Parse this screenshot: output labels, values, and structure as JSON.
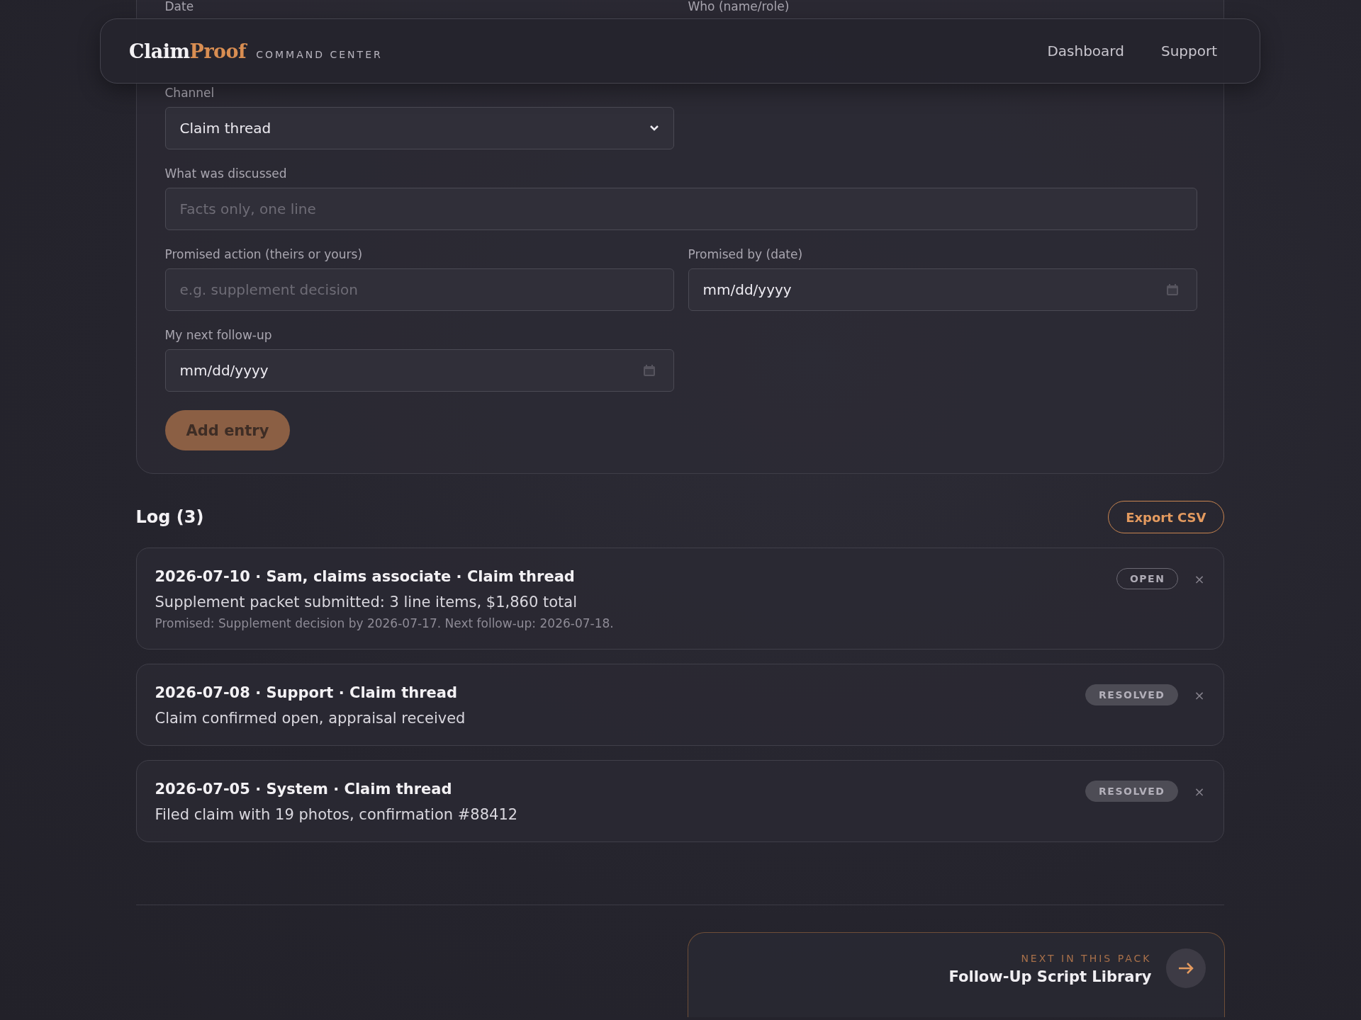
{
  "header": {
    "brand_main": "Claim",
    "brand_accent": "Proof",
    "subtitle": "COMMAND CENTER",
    "nav": [
      {
        "label": "Dashboard"
      },
      {
        "label": "Support"
      }
    ]
  },
  "form": {
    "top_labels": [
      "Date",
      "Who (name/role)"
    ],
    "channel": {
      "label": "Channel",
      "value": "Claim thread"
    },
    "discussed": {
      "label": "What was discussed",
      "placeholder": "Facts only, one line"
    },
    "promised_action": {
      "label": "Promised action (theirs or yours)",
      "placeholder": "e.g. supplement decision"
    },
    "promised_by": {
      "label": "Promised by (date)",
      "value": "mm/dd/yyyy"
    },
    "next_follow_up": {
      "label": "My next follow-up",
      "value": "mm/dd/yyyy"
    },
    "submit": "Add entry"
  },
  "log": {
    "title": "Log (3)",
    "export": "Export CSV",
    "entries": [
      {
        "heading": "2026-07-10 · Sam, claims associate · Claim thread",
        "summary": "Supplement packet submitted: 3 line items, $1,860 total",
        "detail": "Promised: Supplement decision by 2026-07-17. Next follow-up: 2026-07-18.",
        "status": {
          "kind": "open",
          "label": "OPEN"
        },
        "remove": "×"
      },
      {
        "heading": "2026-07-08 · Support · Claim thread",
        "summary": "Claim confirmed open, appraisal received",
        "status": {
          "kind": "resolved",
          "label": "RESOLVED"
        },
        "remove": "×"
      },
      {
        "heading": "2026-07-05 · System · Claim thread",
        "summary": "Filed claim with 19 photos, confirmation #88412",
        "status": {
          "kind": "resolved",
          "label": "RESOLVED"
        },
        "remove": "×"
      }
    ]
  },
  "next": {
    "eyebrow": "NEXT IN THIS PACK",
    "title": "Follow-Up Script Library"
  }
}
